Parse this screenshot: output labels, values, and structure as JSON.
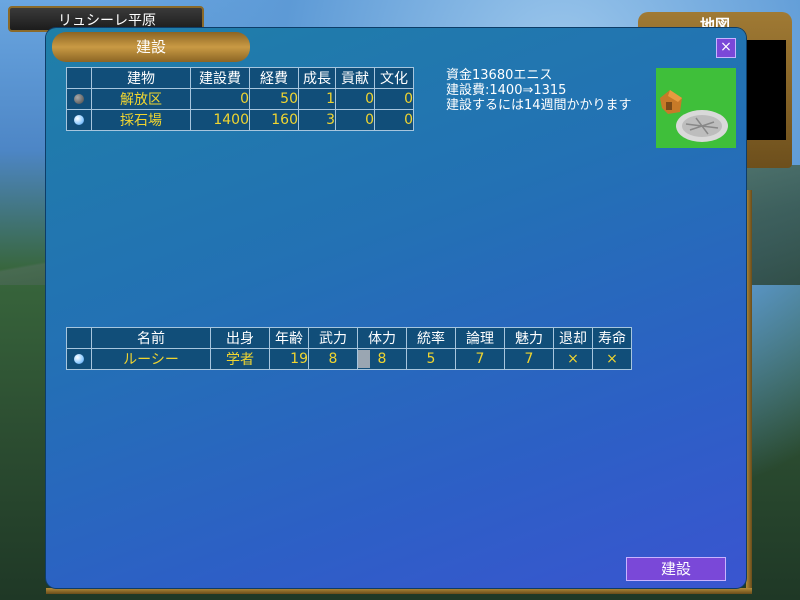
{
  "location": {
    "name": "リュシーレ平原"
  },
  "map_panel": {
    "title": "地図"
  },
  "dialog": {
    "title": "建設",
    "close_label": "×"
  },
  "buildings_table": {
    "headers": [
      "",
      "建物",
      "建設費",
      "経費",
      "成長",
      "貢献",
      "文化"
    ],
    "rows": [
      {
        "selected": false,
        "name": "解放区",
        "cost": "0",
        "upkeep": "50",
        "growth": "1",
        "contribution": "0",
        "culture": "0"
      },
      {
        "selected": true,
        "name": "採石場",
        "cost": "1400",
        "upkeep": "160",
        "growth": "3",
        "contribution": "0",
        "culture": "0"
      }
    ]
  },
  "info": {
    "funds": "資金13680エニス",
    "cost_line": "建設費:1400⇒1315",
    "duration": "建設するには14週間かかります"
  },
  "characters_table": {
    "headers": [
      "",
      "名前",
      "出身",
      "年齢",
      "武力",
      "体力",
      "統率",
      "論理",
      "魅力",
      "退却",
      "寿命"
    ],
    "rows": [
      {
        "selected": true,
        "name": "ルーシー",
        "origin": "学者",
        "age": "19",
        "strength": "8",
        "stamina": "8",
        "stamina_level": 0.25,
        "command": "5",
        "logic": "7",
        "charm": "7",
        "retreat": "×",
        "lifespan": "×"
      }
    ]
  },
  "actions": {
    "build_label": "建設"
  }
}
